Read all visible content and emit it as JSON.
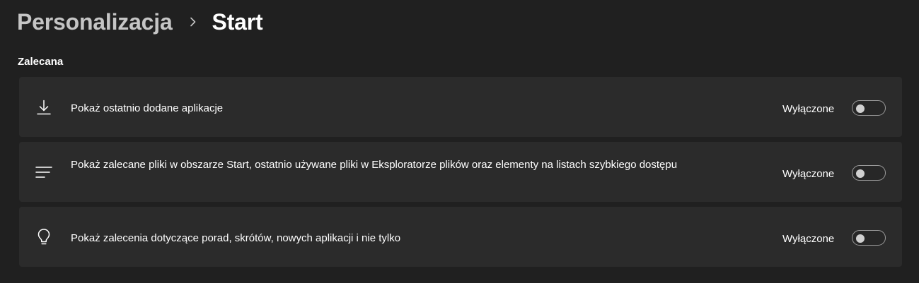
{
  "breadcrumb": {
    "parent": "Personalizacja",
    "separator_icon": "chevron-right-icon",
    "current": "Start"
  },
  "section": {
    "title": "Zalecana"
  },
  "settings": [
    {
      "icon": "download-icon",
      "label": "Pokaż ostatnio dodane aplikacje",
      "state": "Wyłączone",
      "enabled": false
    },
    {
      "icon": "list-lines-icon",
      "label": "Pokaż zalecane pliki w obszarze Start, ostatnio używane pliki w Eksploratorze plików oraz elementy na listach szybkiego dostępu",
      "state": "Wyłączone",
      "enabled": false
    },
    {
      "icon": "lightbulb-icon",
      "label": "Pokaż zalecenia dotyczące porad, skrótów, nowych aplikacji i nie tylko",
      "state": "Wyłączone",
      "enabled": false
    }
  ],
  "colors": {
    "background": "#202020",
    "card": "#2b2b2b",
    "text": "#ffffff",
    "muted_text": "#c5c5c5",
    "toggle_border": "#9a9a9a"
  }
}
